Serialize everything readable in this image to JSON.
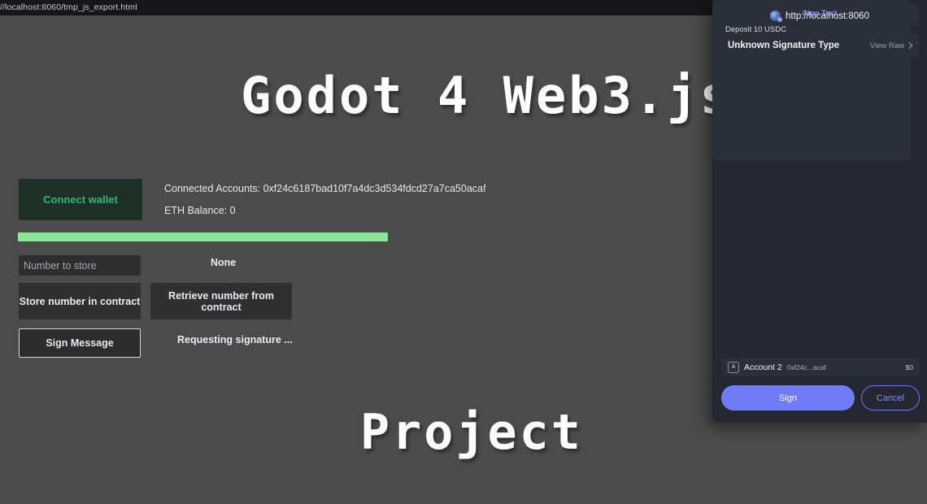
{
  "browser": {
    "url": "//localhost:8060/tmp_js_export.html"
  },
  "game": {
    "title_main": "Godot 4 Web3.js",
    "title_sub": "Project"
  },
  "dapp": {
    "connect_wallet_label": "Connect wallet",
    "connected_accounts_text": "Connected Accounts: 0xf24c6187bad10f7a4dc3d534fdcd27a7ca50acaf",
    "eth_balance_text": "ETH Balance: 0",
    "number_input_placeholder": "Number to store",
    "number_input_value": "",
    "retrieved_value": "None",
    "store_number_label": "Store number in contract",
    "retrieve_number_label": "Retrieve number from contract",
    "sign_message_label": "Sign Message",
    "signature_status": "Requesting signature ...",
    "progress_color": "#8ce69a",
    "connect_accent_color": "#2fb878"
  },
  "metamask": {
    "origin_url": "http://localhost:8060",
    "signature_type_label": "Unknown Signature Type",
    "view_raw_label": "View Raw",
    "sign_text_heading": "Sign Text",
    "message_body": "Deposit 10 USDC",
    "account_avatar_letter": "A",
    "account_name": "Account 2",
    "account_address": "0xf24c...acaf",
    "account_balance": "$0",
    "sign_button_label": "Sign",
    "cancel_button_label": "Cancel",
    "accent_color": "#6f7bf7"
  }
}
